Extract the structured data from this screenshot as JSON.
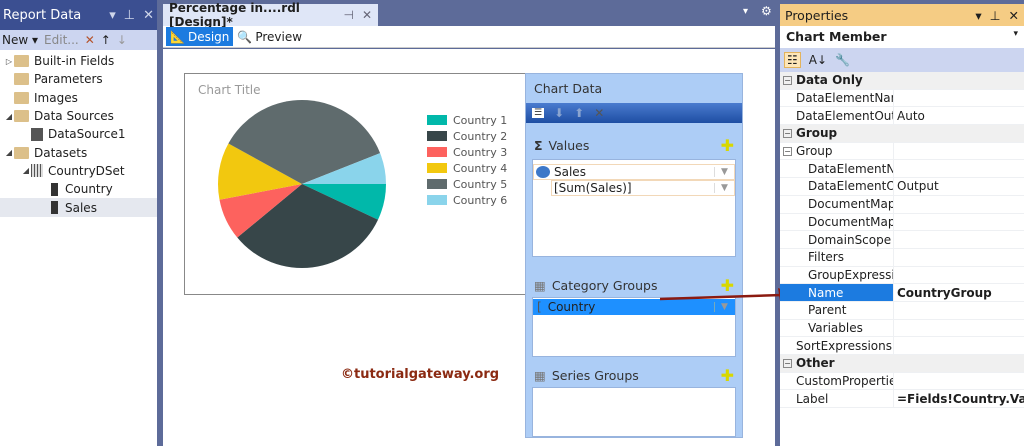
{
  "report_data": {
    "title": "Report Data",
    "toolbar": {
      "new": "New",
      "edit": "Edit..."
    },
    "tree": [
      {
        "label": "Built-in Fields",
        "level": 0,
        "tw": "▷",
        "icon": "folder"
      },
      {
        "label": "Parameters",
        "level": 0,
        "tw": "",
        "icon": "folder"
      },
      {
        "label": "Images",
        "level": 0,
        "tw": "",
        "icon": "folder"
      },
      {
        "label": "Data Sources",
        "level": 0,
        "tw": "◢",
        "icon": "folder-open"
      },
      {
        "label": "DataSource1",
        "level": 1,
        "tw": "",
        "icon": "datasource"
      },
      {
        "label": "Datasets",
        "level": 0,
        "tw": "◢",
        "icon": "folder-open"
      },
      {
        "label": "CountryDSet",
        "level": 1,
        "tw": "◢",
        "icon": "table"
      },
      {
        "label": "Country",
        "level": 2,
        "tw": "",
        "icon": "field"
      },
      {
        "label": "Sales",
        "level": 2,
        "tw": "",
        "icon": "field",
        "selected": true
      }
    ]
  },
  "document": {
    "tab_title": "Percentage in....rdl [Design]*",
    "view_tabs": {
      "design": "Design",
      "preview": "Preview"
    }
  },
  "chart": {
    "title": "Chart Title",
    "legend": [
      "Country 1",
      "Country 2",
      "Country 3",
      "Country 4",
      "Country 5",
      "Country 6"
    ]
  },
  "chart_data": {
    "type": "pie",
    "title": "Chart Title",
    "categories": [
      "Country 1",
      "Country 2",
      "Country 3",
      "Country 4",
      "Country 5",
      "Country 6"
    ],
    "values": [
      7,
      32,
      8,
      11,
      36,
      6
    ],
    "colors": [
      "#01b8aa",
      "#374649",
      "#fd625e",
      "#f2c80f",
      "#5f6b6d",
      "#8ad4eb"
    ],
    "legend": "right"
  },
  "chart_data_pane": {
    "title": "Chart Data",
    "values_label": "Values",
    "value_field": "Sales",
    "value_expr": "[Sum(Sales)]",
    "category_label": "Category Groups",
    "category_field": "Country",
    "series_label": "Series Groups"
  },
  "watermark": "©tutorialgateway.org",
  "properties": {
    "title": "Properties",
    "object": "Chart Member",
    "rows": [
      {
        "cat": "Data Only"
      },
      {
        "n": "DataElementName",
        "v": ""
      },
      {
        "n": "DataElementOutput",
        "v": "Auto"
      },
      {
        "cat": "Group"
      },
      {
        "n": "Group",
        "v": "",
        "group": true
      },
      {
        "n": "DataElementName",
        "v": "",
        "ind": true
      },
      {
        "n": "DataElementOutput",
        "v": "Output",
        "ind": true
      },
      {
        "n": "DocumentMapLabel",
        "v": "",
        "ind": true
      },
      {
        "n": "DocumentMapLevel",
        "v": "",
        "ind": true
      },
      {
        "n": "DomainScope",
        "v": "",
        "ind": true
      },
      {
        "n": "Filters",
        "v": "",
        "ind": true
      },
      {
        "n": "GroupExpressions",
        "v": "",
        "ind": true
      },
      {
        "n": "Name",
        "v": "CountryGroup",
        "ind": true,
        "sel": true
      },
      {
        "n": "Parent",
        "v": "",
        "ind": true
      },
      {
        "n": "Variables",
        "v": "",
        "ind": true
      },
      {
        "n": "SortExpressions",
        "v": ""
      },
      {
        "cat": "Other"
      },
      {
        "n": "CustomProperties",
        "v": ""
      },
      {
        "n": "Label",
        "v": "=Fields!Country.Value",
        "bold": true
      }
    ]
  }
}
